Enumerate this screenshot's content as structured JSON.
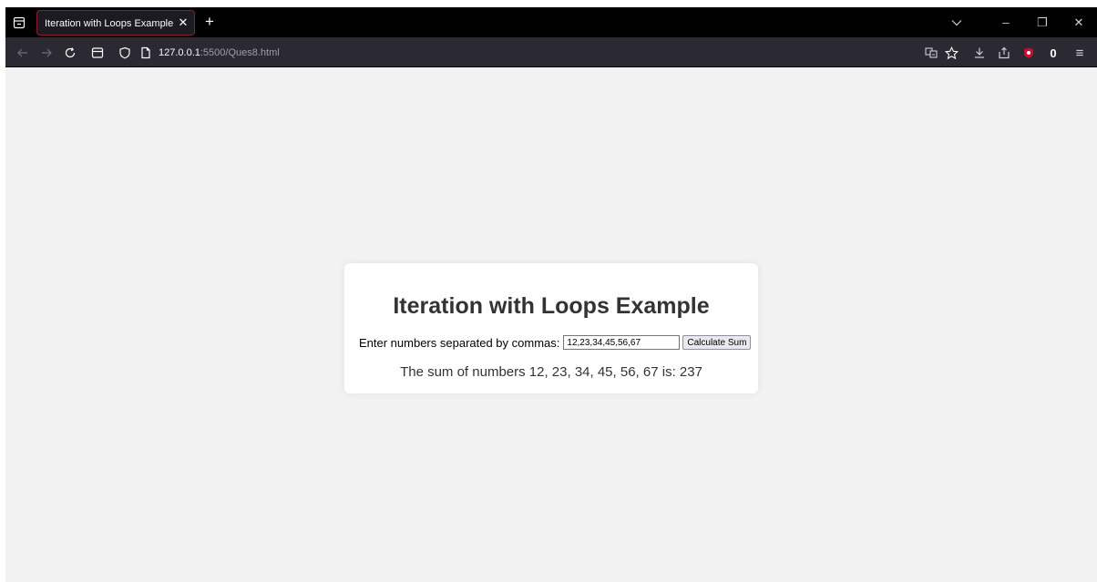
{
  "tab": {
    "title": "Iteration with Loops Example",
    "close": "✕",
    "new": "+"
  },
  "window_controls": {
    "minimize": "–",
    "restore": "❐",
    "close": "✕"
  },
  "address": {
    "host": "127.0.0.1",
    "path": ":5500/Ques8.html"
  },
  "toolbar": {
    "account_badge": "0",
    "menu": "≡"
  },
  "page": {
    "title": "Iteration with Loops Example",
    "input_label": "Enter numbers separated by commas:",
    "input_value": "12,23,34,45,56,67",
    "button_label": "Calculate Sum",
    "result": "The sum of numbers 12, 23, 34, 45, 56, 67 is: 237"
  },
  "icons": [
    "tab-list-icon",
    "chevron-down-icon",
    "back-icon",
    "forward-icon",
    "reload-icon",
    "reader-view-icon",
    "shield-icon",
    "page-icon",
    "translate-icon",
    "star-icon",
    "download-icon",
    "share-icon",
    "ublock-icon"
  ],
  "colors": {
    "page_bg": "#f2f2f2",
    "card_bg": "#ffffff",
    "text": "#333333",
    "tab_border": "#8a1d2a",
    "toolbar": "#2b2a33"
  }
}
